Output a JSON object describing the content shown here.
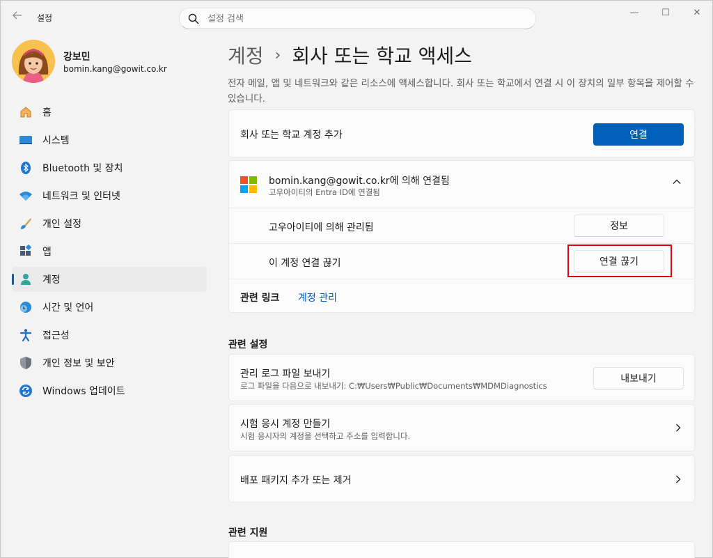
{
  "titlebar": {
    "back_icon": "back-arrow-icon",
    "app_title": "설정",
    "search_placeholder": "설정 검색",
    "minimize": "—",
    "maximize": "☐",
    "close": "✕"
  },
  "profile": {
    "name": "강보민",
    "email": "bomin.kang@gowit.co.kr"
  },
  "sidebar": {
    "items": [
      {
        "label": "홈",
        "icon": "home-icon"
      },
      {
        "label": "시스템",
        "icon": "system-icon"
      },
      {
        "label": "Bluetooth 및 장치",
        "icon": "bluetooth-icon"
      },
      {
        "label": "네트워크 및 인터넷",
        "icon": "wifi-icon"
      },
      {
        "label": "개인 설정",
        "icon": "brush-icon"
      },
      {
        "label": "앱",
        "icon": "apps-icon"
      },
      {
        "label": "계정",
        "icon": "account-icon",
        "active": true
      },
      {
        "label": "시간 및 언어",
        "icon": "time-language-icon"
      },
      {
        "label": "접근성",
        "icon": "accessibility-icon"
      },
      {
        "label": "개인 정보 및 보안",
        "icon": "shield-icon"
      },
      {
        "label": "Windows 업데이트",
        "icon": "update-icon"
      }
    ]
  },
  "main": {
    "breadcrumb_parent": "계정",
    "breadcrumb_sep": "›",
    "breadcrumb_current": "회사 또는 학교 액세스",
    "description": "전자 메일, 앱 및 네트워크와 같은 리소스에 액세스합니다. 회사 또는 학교에서 연결 시 이 장치의 일부 항목을 제어할 수 있습니다.",
    "add_account": {
      "label": "회사 또는 학교 계정 추가",
      "button": "연결"
    },
    "connected": {
      "title": "bomin.kang@gowit.co.kr에 의해 연결됨",
      "subtitle": "고우아이티의 Entra ID에 연결됨",
      "managed_label": "고우아이티에 의해 관리됨",
      "info_button": "정보",
      "disconnect_label": "이 계정 연결 끊기",
      "disconnect_button": "연결 끊기",
      "related_links_label": "관련 링크",
      "manage_account_link": "계정 관리"
    },
    "related_settings_title": "관련 설정",
    "export_logs": {
      "title": "관리 로그 파일 보내기",
      "subtitle": "로그 파일을 다음으로 내보내기: C:₩Users₩Public₩Documents₩MDMDiagnostics",
      "button": "내보내기"
    },
    "test_account": {
      "title": "시험 응시 계정 만들기",
      "subtitle": "시험 응시자의 계정을 선택하고 주소를 입력합니다."
    },
    "provisioning": {
      "title": "배포 패키지 추가 또는 제거"
    },
    "related_support_title": "관련 지원"
  },
  "colors": {
    "accent": "#005fb8",
    "highlight": "#e0000f"
  }
}
